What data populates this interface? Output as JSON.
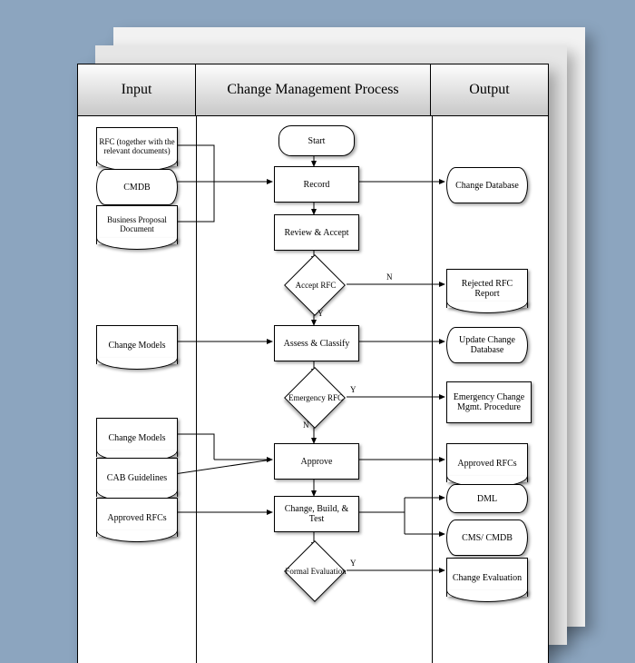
{
  "headers": {
    "input": "Input",
    "process": "Change Management Process",
    "output": "Output"
  },
  "inputs": {
    "rfc": "RFC (together with the relevant documents)",
    "cmdb": "CMDB",
    "bpd": "Business Proposal Document",
    "cm1": "Change Models",
    "cm2": "Change Models",
    "cab": "CAB Guidelines",
    "arfc": "Approved RFCs"
  },
  "process": {
    "start": "Start",
    "record": "Record",
    "review": "Review & Accept",
    "acceptRfc": "Accept RFC",
    "assess": "Assess & Classify",
    "emergency": "Emergency RFC",
    "approve": "Approve",
    "cbt": "Change, Build, & Test",
    "formal": "Formal Evaluation"
  },
  "outputs": {
    "cdb": "Change Database",
    "rej": "Rejected RFC Report",
    "upd": "Update Change Database",
    "emg": "Emergency Change Mgmt. Procedure",
    "apr": "Approved RFCs",
    "dml": "DML",
    "cms": "CMS/ CMDB",
    "ceval": "Change Evaluation"
  },
  "labels": {
    "Y": "Y",
    "N": "N"
  }
}
